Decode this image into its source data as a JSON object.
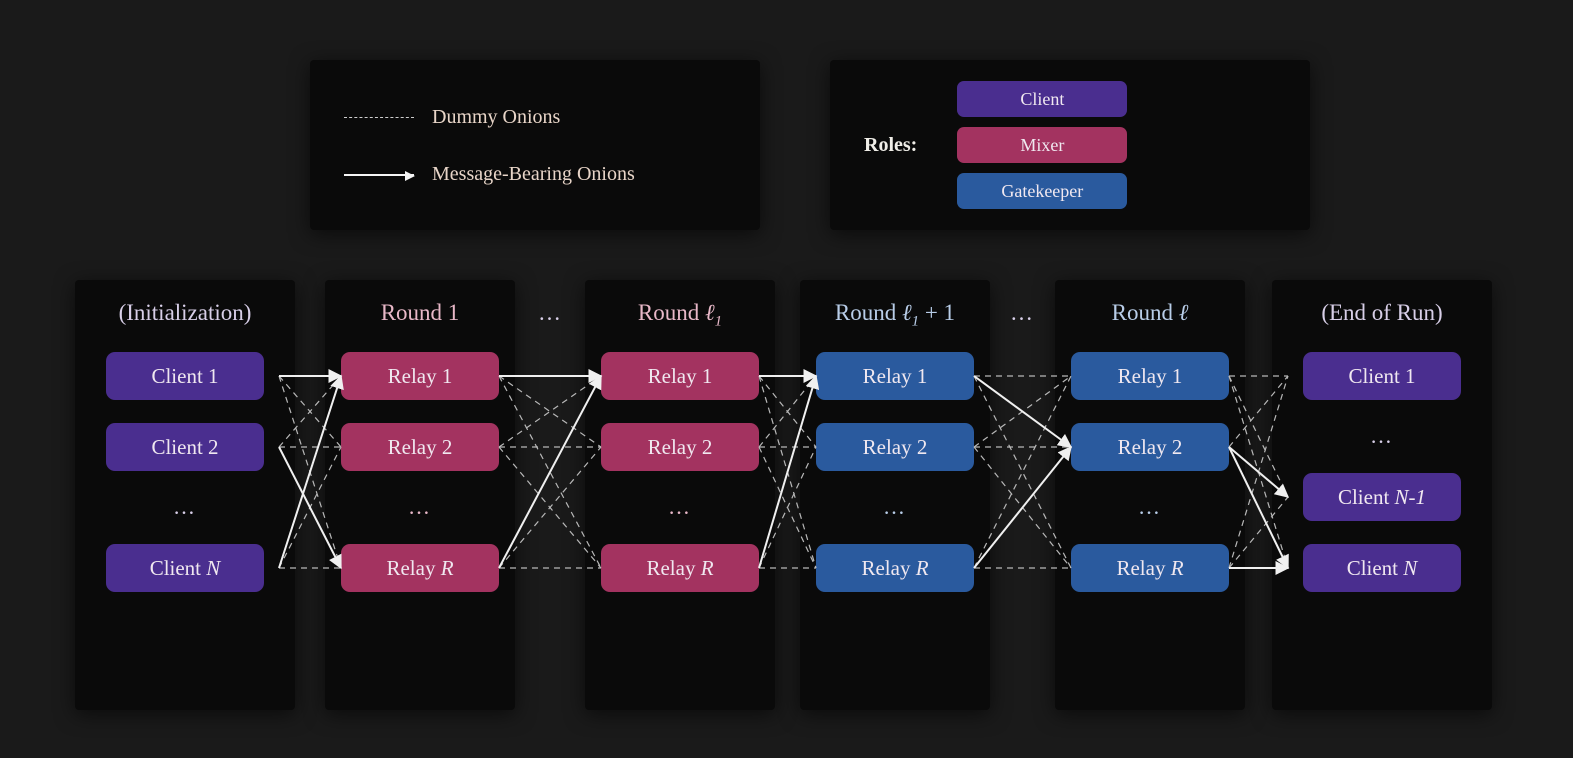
{
  "legend": {
    "dummy": "Dummy Onions",
    "message": "Message-Bearing Onions"
  },
  "roles": {
    "title": "Roles:",
    "client": "Client",
    "mixer": "Mixer",
    "gatekeeper": "Gatekeeper"
  },
  "colors": {
    "client": "#4a2e8f",
    "mixer": "#a33360",
    "gatekeeper": "#2a5a9e"
  },
  "stages": {
    "init": {
      "title": "(Initialization)",
      "nodes": [
        "Client 1",
        "Client 2",
        "Client N"
      ],
      "ellipsis": "…"
    },
    "round1": {
      "title_prefix": "Round ",
      "title_num": "1",
      "nodes": [
        "Relay 1",
        "Relay 2",
        "Relay R"
      ],
      "ellipsis": "…"
    },
    "between12": "…",
    "roundL1": {
      "title_prefix": "Round ",
      "title_var": "ℓ",
      "title_sub": "1",
      "nodes": [
        "Relay 1",
        "Relay 2",
        "Relay R"
      ],
      "ellipsis": "…"
    },
    "roundL1p1": {
      "title_prefix": "Round ",
      "title_var": "ℓ",
      "title_sub": "1",
      "title_suffix": " + 1",
      "nodes": [
        "Relay 1",
        "Relay 2",
        "Relay R"
      ],
      "ellipsis": "…"
    },
    "between34": "…",
    "roundL": {
      "title_prefix": "Round ",
      "title_var": "ℓ",
      "nodes": [
        "Relay 1",
        "Relay 2",
        "Relay R"
      ],
      "ellipsis": "…"
    },
    "end": {
      "title": "(End of Run)",
      "nodes": [
        "Client 1",
        "Client N-1",
        "Client N"
      ],
      "top_ellipsis": "…"
    }
  }
}
